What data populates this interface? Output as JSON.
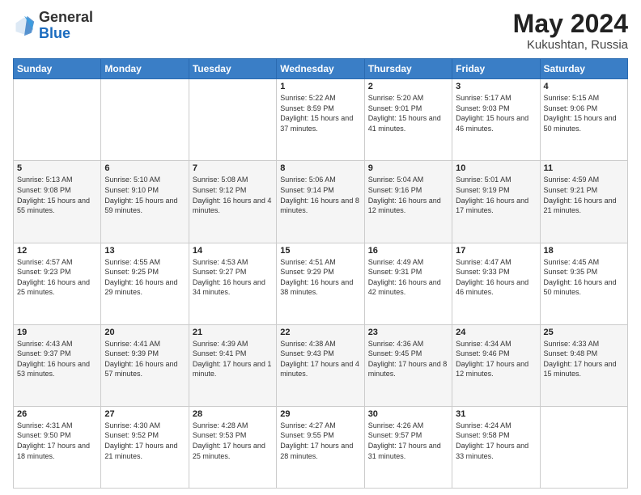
{
  "header": {
    "logo_general": "General",
    "logo_blue": "Blue",
    "title": "May 2024",
    "location": "Kukushtan, Russia"
  },
  "days_of_week": [
    "Sunday",
    "Monday",
    "Tuesday",
    "Wednesday",
    "Thursday",
    "Friday",
    "Saturday"
  ],
  "weeks": [
    [
      {
        "day": "",
        "info": ""
      },
      {
        "day": "",
        "info": ""
      },
      {
        "day": "",
        "info": ""
      },
      {
        "day": "1",
        "info": "Sunrise: 5:22 AM\nSunset: 8:59 PM\nDaylight: 15 hours\nand 37 minutes."
      },
      {
        "day": "2",
        "info": "Sunrise: 5:20 AM\nSunset: 9:01 PM\nDaylight: 15 hours\nand 41 minutes."
      },
      {
        "day": "3",
        "info": "Sunrise: 5:17 AM\nSunset: 9:03 PM\nDaylight: 15 hours\nand 46 minutes."
      },
      {
        "day": "4",
        "info": "Sunrise: 5:15 AM\nSunset: 9:06 PM\nDaylight: 15 hours\nand 50 minutes."
      }
    ],
    [
      {
        "day": "5",
        "info": "Sunrise: 5:13 AM\nSunset: 9:08 PM\nDaylight: 15 hours\nand 55 minutes."
      },
      {
        "day": "6",
        "info": "Sunrise: 5:10 AM\nSunset: 9:10 PM\nDaylight: 15 hours\nand 59 minutes."
      },
      {
        "day": "7",
        "info": "Sunrise: 5:08 AM\nSunset: 9:12 PM\nDaylight: 16 hours\nand 4 minutes."
      },
      {
        "day": "8",
        "info": "Sunrise: 5:06 AM\nSunset: 9:14 PM\nDaylight: 16 hours\nand 8 minutes."
      },
      {
        "day": "9",
        "info": "Sunrise: 5:04 AM\nSunset: 9:16 PM\nDaylight: 16 hours\nand 12 minutes."
      },
      {
        "day": "10",
        "info": "Sunrise: 5:01 AM\nSunset: 9:19 PM\nDaylight: 16 hours\nand 17 minutes."
      },
      {
        "day": "11",
        "info": "Sunrise: 4:59 AM\nSunset: 9:21 PM\nDaylight: 16 hours\nand 21 minutes."
      }
    ],
    [
      {
        "day": "12",
        "info": "Sunrise: 4:57 AM\nSunset: 9:23 PM\nDaylight: 16 hours\nand 25 minutes."
      },
      {
        "day": "13",
        "info": "Sunrise: 4:55 AM\nSunset: 9:25 PM\nDaylight: 16 hours\nand 29 minutes."
      },
      {
        "day": "14",
        "info": "Sunrise: 4:53 AM\nSunset: 9:27 PM\nDaylight: 16 hours\nand 34 minutes."
      },
      {
        "day": "15",
        "info": "Sunrise: 4:51 AM\nSunset: 9:29 PM\nDaylight: 16 hours\nand 38 minutes."
      },
      {
        "day": "16",
        "info": "Sunrise: 4:49 AM\nSunset: 9:31 PM\nDaylight: 16 hours\nand 42 minutes."
      },
      {
        "day": "17",
        "info": "Sunrise: 4:47 AM\nSunset: 9:33 PM\nDaylight: 16 hours\nand 46 minutes."
      },
      {
        "day": "18",
        "info": "Sunrise: 4:45 AM\nSunset: 9:35 PM\nDaylight: 16 hours\nand 50 minutes."
      }
    ],
    [
      {
        "day": "19",
        "info": "Sunrise: 4:43 AM\nSunset: 9:37 PM\nDaylight: 16 hours\nand 53 minutes."
      },
      {
        "day": "20",
        "info": "Sunrise: 4:41 AM\nSunset: 9:39 PM\nDaylight: 16 hours\nand 57 minutes."
      },
      {
        "day": "21",
        "info": "Sunrise: 4:39 AM\nSunset: 9:41 PM\nDaylight: 17 hours\nand 1 minute."
      },
      {
        "day": "22",
        "info": "Sunrise: 4:38 AM\nSunset: 9:43 PM\nDaylight: 17 hours\nand 4 minutes."
      },
      {
        "day": "23",
        "info": "Sunrise: 4:36 AM\nSunset: 9:45 PM\nDaylight: 17 hours\nand 8 minutes."
      },
      {
        "day": "24",
        "info": "Sunrise: 4:34 AM\nSunset: 9:46 PM\nDaylight: 17 hours\nand 12 minutes."
      },
      {
        "day": "25",
        "info": "Sunrise: 4:33 AM\nSunset: 9:48 PM\nDaylight: 17 hours\nand 15 minutes."
      }
    ],
    [
      {
        "day": "26",
        "info": "Sunrise: 4:31 AM\nSunset: 9:50 PM\nDaylight: 17 hours\nand 18 minutes."
      },
      {
        "day": "27",
        "info": "Sunrise: 4:30 AM\nSunset: 9:52 PM\nDaylight: 17 hours\nand 21 minutes."
      },
      {
        "day": "28",
        "info": "Sunrise: 4:28 AM\nSunset: 9:53 PM\nDaylight: 17 hours\nand 25 minutes."
      },
      {
        "day": "29",
        "info": "Sunrise: 4:27 AM\nSunset: 9:55 PM\nDaylight: 17 hours\nand 28 minutes."
      },
      {
        "day": "30",
        "info": "Sunrise: 4:26 AM\nSunset: 9:57 PM\nDaylight: 17 hours\nand 31 minutes."
      },
      {
        "day": "31",
        "info": "Sunrise: 4:24 AM\nSunset: 9:58 PM\nDaylight: 17 hours\nand 33 minutes."
      },
      {
        "day": "",
        "info": ""
      }
    ]
  ]
}
